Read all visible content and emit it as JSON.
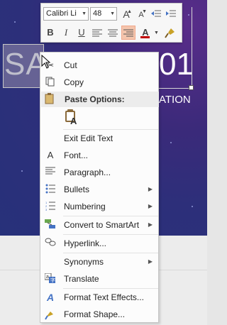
{
  "toolbar": {
    "font_name": "Calibri Li",
    "font_size": "48",
    "grow_font": "A",
    "shrink_font": "A",
    "bold": "B",
    "italic": "I",
    "underline": "U",
    "font_color_letter": "A",
    "font_color": "#c00000",
    "active_button": "align-right"
  },
  "slide": {
    "title_left": "SA",
    "title_right": "01",
    "subtitle_fragment": "ATION"
  },
  "menu": {
    "cut": "Cut",
    "copy": "Copy",
    "paste_options": "Paste Options:",
    "paste_keep_text": "A",
    "exit_edit_text": "Exit Edit Text",
    "font": "Font...",
    "paragraph": "Paragraph...",
    "bullets": "Bullets",
    "numbering": "Numbering",
    "convert_smartart": "Convert to SmartArt",
    "hyperlink": "Hyperlink...",
    "synonyms": "Synonyms",
    "translate": "Translate",
    "format_text_effects": "Format Text Effects...",
    "format_shape": "Format Shape..."
  },
  "icons": {
    "cut": "scissors-icon",
    "copy": "copy-icon",
    "paste": "clipboard-icon",
    "font": "font-a-icon",
    "paragraph": "paragraph-icon",
    "bullets": "bullets-icon",
    "numbering": "numbering-icon",
    "smartart": "smartart-icon",
    "hyperlink": "link-icon",
    "translate": "translate-icon",
    "text_effects": "text-effects-icon",
    "format_shape": "format-shape-icon"
  }
}
